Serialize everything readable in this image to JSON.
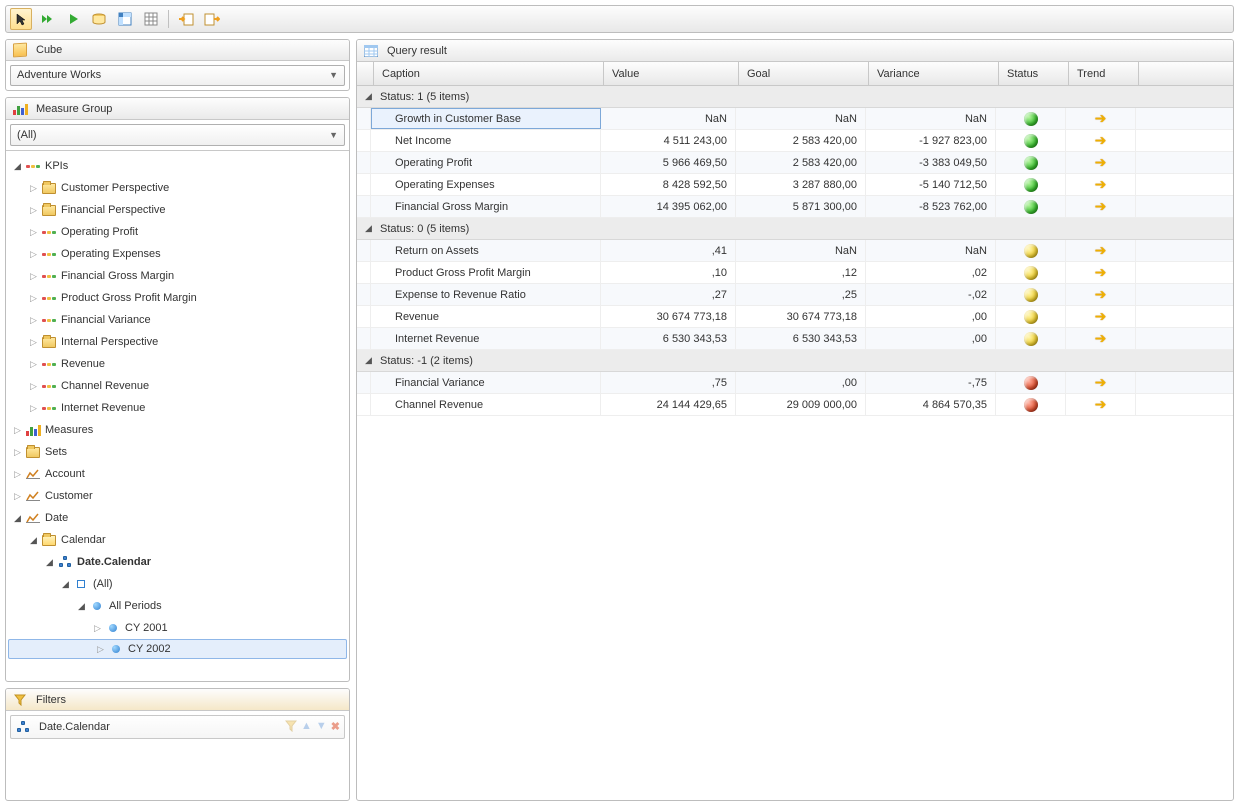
{
  "toolbar": {
    "buttons": [
      "cursor-tool",
      "auto-run",
      "run",
      "view-sql",
      "pivot",
      "grid",
      "import",
      "export"
    ]
  },
  "cube": {
    "header": "Cube",
    "selected": "Adventure Works"
  },
  "measure_group": {
    "header": "Measure Group",
    "selected": "(All)"
  },
  "tree": [
    {
      "type": "kpi-root",
      "label": "KPIs",
      "expanded": true,
      "depth": 0,
      "children": [
        {
          "type": "folder",
          "label": "Customer Perspective",
          "depth": 1
        },
        {
          "type": "folder",
          "label": "Financial Perspective",
          "depth": 1
        },
        {
          "type": "kpi",
          "label": "Operating Profit",
          "depth": 1
        },
        {
          "type": "kpi",
          "label": "Operating Expenses",
          "depth": 1
        },
        {
          "type": "kpi",
          "label": "Financial Gross Margin",
          "depth": 1
        },
        {
          "type": "kpi",
          "label": "Product Gross Profit Margin",
          "depth": 1
        },
        {
          "type": "kpi",
          "label": "Financial Variance",
          "depth": 1
        },
        {
          "type": "folder",
          "label": "Internal Perspective",
          "depth": 1
        },
        {
          "type": "kpi",
          "label": "Revenue",
          "depth": 1
        },
        {
          "type": "kpi",
          "label": "Channel Revenue",
          "depth": 1
        },
        {
          "type": "kpi",
          "label": "Internet Revenue",
          "depth": 1
        }
      ]
    },
    {
      "type": "measures",
      "label": "Measures",
      "depth": 0
    },
    {
      "type": "folder",
      "label": "Sets",
      "depth": 0
    },
    {
      "type": "dim",
      "label": "Account",
      "depth": 0
    },
    {
      "type": "dim",
      "label": "Customer",
      "depth": 0
    },
    {
      "type": "dim",
      "label": "Date",
      "expanded": true,
      "depth": 0,
      "children": [
        {
          "type": "folder-open",
          "label": "Calendar",
          "expanded": true,
          "depth": 1,
          "children": [
            {
              "type": "hierarchy",
              "label": "Date.Calendar",
              "expanded": true,
              "bold": true,
              "depth": 2,
              "children": [
                {
                  "type": "level",
                  "label": "(All)",
                  "expanded": true,
                  "depth": 3,
                  "children": [
                    {
                      "type": "member",
                      "label": "All Periods",
                      "expanded": true,
                      "depth": 4,
                      "children": [
                        {
                          "type": "member",
                          "label": "CY 2001",
                          "depth": 5
                        },
                        {
                          "type": "member",
                          "label": "CY 2002",
                          "depth": 5,
                          "selected": true
                        }
                      ]
                    }
                  ]
                }
              ]
            }
          ]
        }
      ]
    }
  ],
  "filters": {
    "header": "Filters",
    "items": [
      {
        "icon": "hierarchy",
        "label": "Date.Calendar"
      }
    ]
  },
  "result": {
    "header": "Query result",
    "columns": [
      "Caption",
      "Value",
      "Goal",
      "Variance",
      "Status",
      "Trend"
    ],
    "groups": [
      {
        "title": "Status: 1 (5 items)",
        "rows": [
          {
            "caption": "Growth in Customer Base",
            "value": "NaN",
            "goal": "NaN",
            "variance": "NaN",
            "status": "green",
            "trend": "flat",
            "focused": true
          },
          {
            "caption": "Net Income",
            "value": "4 511 243,00",
            "goal": "2 583 420,00",
            "variance": "-1 927 823,00",
            "status": "green",
            "trend": "flat"
          },
          {
            "caption": "Operating Profit",
            "value": "5 966 469,50",
            "goal": "2 583 420,00",
            "variance": "-3 383 049,50",
            "status": "green",
            "trend": "flat"
          },
          {
            "caption": "Operating Expenses",
            "value": "8 428 592,50",
            "goal": "3 287 880,00",
            "variance": "-5 140 712,50",
            "status": "green",
            "trend": "flat"
          },
          {
            "caption": "Financial Gross Margin",
            "value": "14 395 062,00",
            "goal": "5 871 300,00",
            "variance": "-8 523 762,00",
            "status": "green",
            "trend": "flat"
          }
        ]
      },
      {
        "title": "Status: 0 (5 items)",
        "rows": [
          {
            "caption": "Return on Assets",
            "value": ",41",
            "goal": "NaN",
            "variance": "NaN",
            "status": "yellow",
            "trend": "flat"
          },
          {
            "caption": "Product Gross Profit Margin",
            "value": ",10",
            "goal": ",12",
            "variance": ",02",
            "status": "yellow",
            "trend": "flat"
          },
          {
            "caption": "Expense to Revenue Ratio",
            "value": ",27",
            "goal": ",25",
            "variance": "-,02",
            "status": "yellow",
            "trend": "flat"
          },
          {
            "caption": "Revenue",
            "value": "30 674 773,18",
            "goal": "30 674 773,18",
            "variance": ",00",
            "status": "yellow",
            "trend": "flat"
          },
          {
            "caption": "Internet Revenue",
            "value": "6 530 343,53",
            "goal": "6 530 343,53",
            "variance": ",00",
            "status": "yellow",
            "trend": "flat"
          }
        ]
      },
      {
        "title": "Status: -1 (2 items)",
        "rows": [
          {
            "caption": "Financial Variance",
            "value": ",75",
            "goal": ",00",
            "variance": "-,75",
            "status": "red",
            "trend": "flat"
          },
          {
            "caption": "Channel Revenue",
            "value": "24 144 429,65",
            "goal": "29 009 000,00",
            "variance": "4 864 570,35",
            "status": "red",
            "trend": "flat"
          }
        ]
      }
    ]
  }
}
